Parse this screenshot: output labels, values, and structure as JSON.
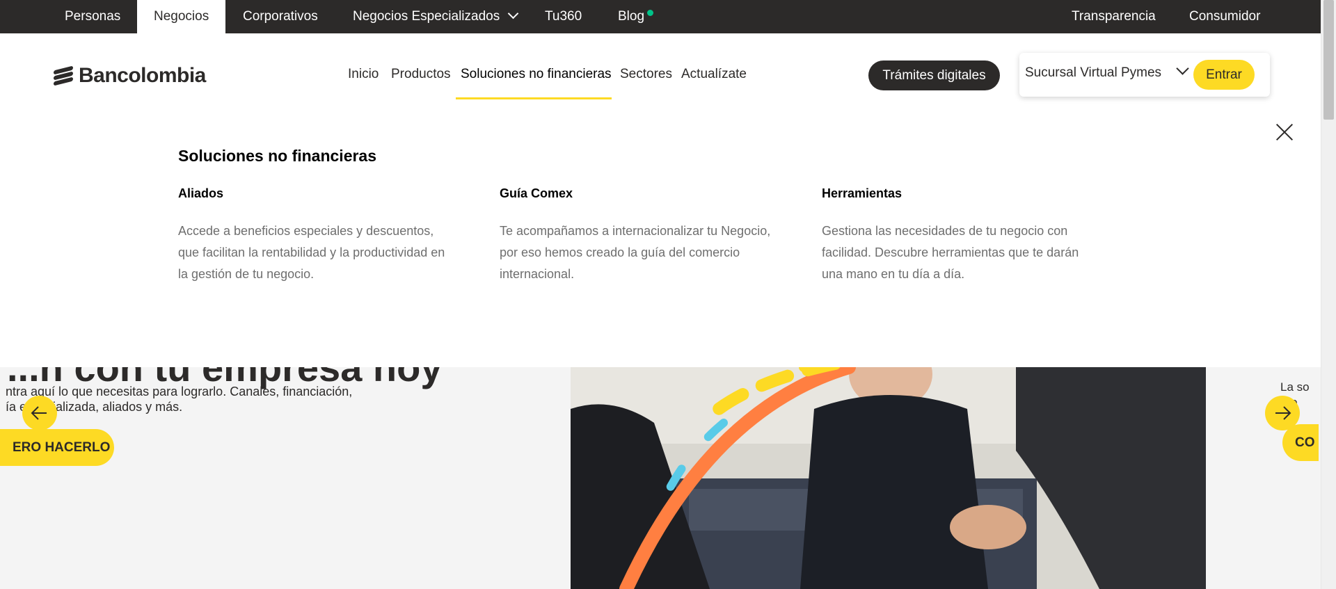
{
  "top_tabs": [
    {
      "label": "Personas"
    },
    {
      "label": "Negocios"
    },
    {
      "label": "Corporativos"
    },
    {
      "label": "Negocios Especializados"
    },
    {
      "label": "Tu360"
    },
    {
      "label": "Blog"
    }
  ],
  "top_right_links": [
    {
      "label": "Transparencia"
    },
    {
      "label": "Consumidor"
    }
  ],
  "brand": {
    "name": "Bancolombia",
    "accent": "#fdda24",
    "dark": "#2c2a29",
    "blog_dot": "#00c389"
  },
  "main_nav": [
    {
      "label": "Inicio"
    },
    {
      "label": "Productos"
    },
    {
      "label": "Soluciones no financieras"
    },
    {
      "label": "Sectores"
    },
    {
      "label": "Actualízate"
    }
  ],
  "header": {
    "tramites_label": "Trámites digitales",
    "sucursal_select": "Sucursal Virtual Pymes",
    "entrar_label": "Entrar"
  },
  "mega_menu": {
    "title": "Soluciones no financieras",
    "columns": [
      {
        "heading": "Aliados",
        "description": "Accede a beneficios especiales y descuentos, que facilitan la rentabilidad y la productividad en la gestión de tu negocio."
      },
      {
        "heading": "Guía Comex",
        "description": "Te acompañamos a internacionalizar tu Negocio, por eso hemos creado la guía del comercio internacional."
      },
      {
        "heading": "Herramientas",
        "description": "Gestiona las necesidades de tu negocio con facilidad. Descubre herramientas que te darán una mano en tu día a día."
      }
    ]
  },
  "hero": {
    "title_fragment": "...n con tu empresa hoy",
    "description": "ntra aquí lo que necesitas para lograrlo. Canales, financiación, ía especializada, aliados y más.",
    "button_label": "ERO HACERLO",
    "right_teaser_line1": "La so",
    "right_teaser_line2": "pro",
    "right_button_label": "CO"
  },
  "icons": {
    "close": "close-icon",
    "prev": "arrow-left-icon",
    "next": "arrow-right-icon",
    "dropdown": "chevron-down-icon"
  }
}
